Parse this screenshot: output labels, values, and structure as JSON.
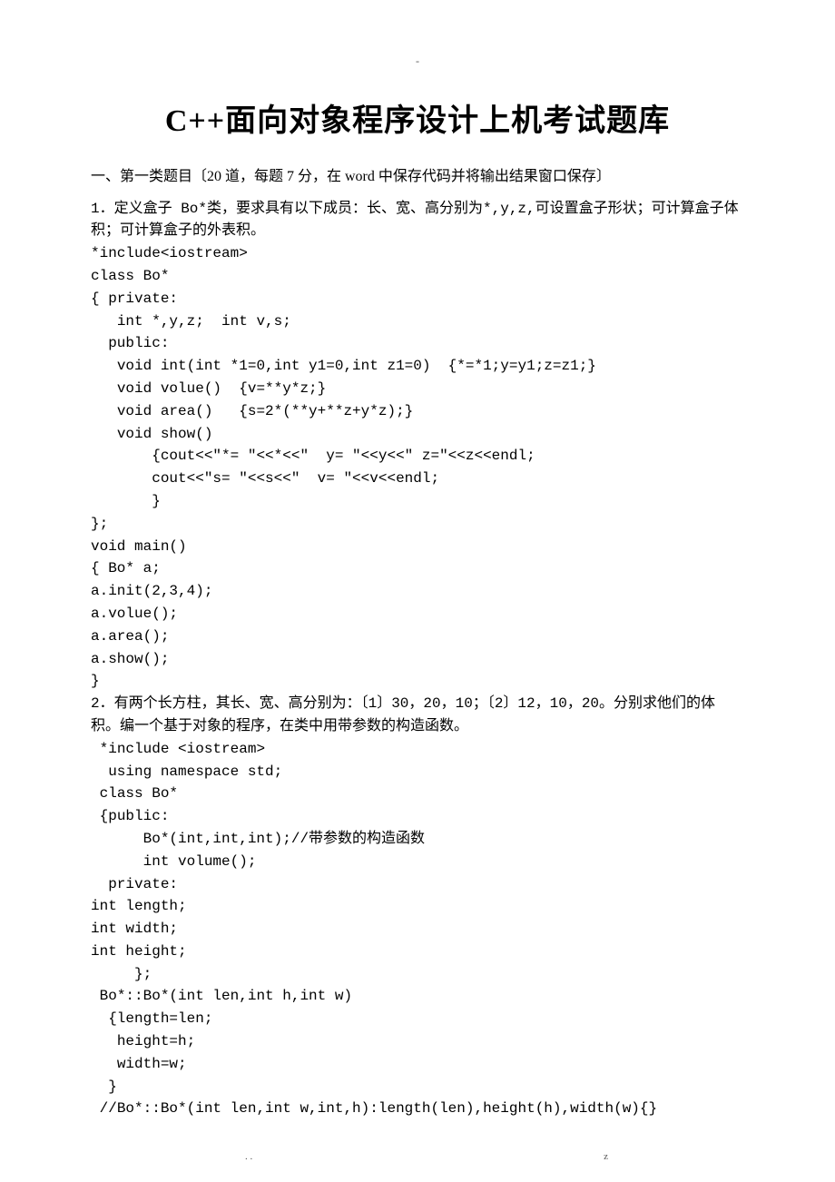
{
  "top_mark": "-",
  "title": "C++面向对象程序设计上机考试题库",
  "section_header": "一、第一类题目〔20 道，每题 7 分，在 word 中保存代码并将输出结果窗口保存〕",
  "q1_intro": "1．定义盒子 Bo*类，要求具有以下成员：长、宽、高分别为*,y,z,可设置盒子形状；可计算盒子体积；可计算盒子的外表积。",
  "q1_code": "*include<iostream>\nclass Bo*\n{ private:\n   int *,y,z;  int v,s;\n  public:\n   void int(int *1=0,int y1=0,int z1=0)  {*=*1;y=y1;z=z1;}\n   void volue()  {v=**y*z;}\n   void area()   {s=2*(**y+**z+y*z);}\n   void show()\n       {cout<<\"*= \"<<*<<\"  y= \"<<y<<\" z=\"<<z<<endl;\n       cout<<\"s= \"<<s<<\"  v= \"<<v<<endl;\n       }\n};\nvoid main()\n{ Bo* a;\na.init(2,3,4);\na.volue();\na.area();\na.show();\n}",
  "q2_intro": "2．有两个长方柱，其长、宽、高分别为：〔1〕30，20，10；〔2〕12，10，20。分别求他们的体积。编一个基于对象的程序，在类中用带参数的构造函数。",
  "q2_code": " *include <iostream>\n  using namespace std;\n class Bo*\n {public:\n      Bo*(int,int,int);//带参数的构造函数\n      int volume();\n  private:\nint length;\nint width;\nint height;\n     };\n Bo*::Bo*(int len,int h,int w)\n  {length=len;\n   height=h;\n   width=w;\n  }\n //Bo*::Bo*(int len,int w,int,h):length(len),height(h),width(w){}",
  "footer_left": ".   .",
  "footer_right": "z"
}
